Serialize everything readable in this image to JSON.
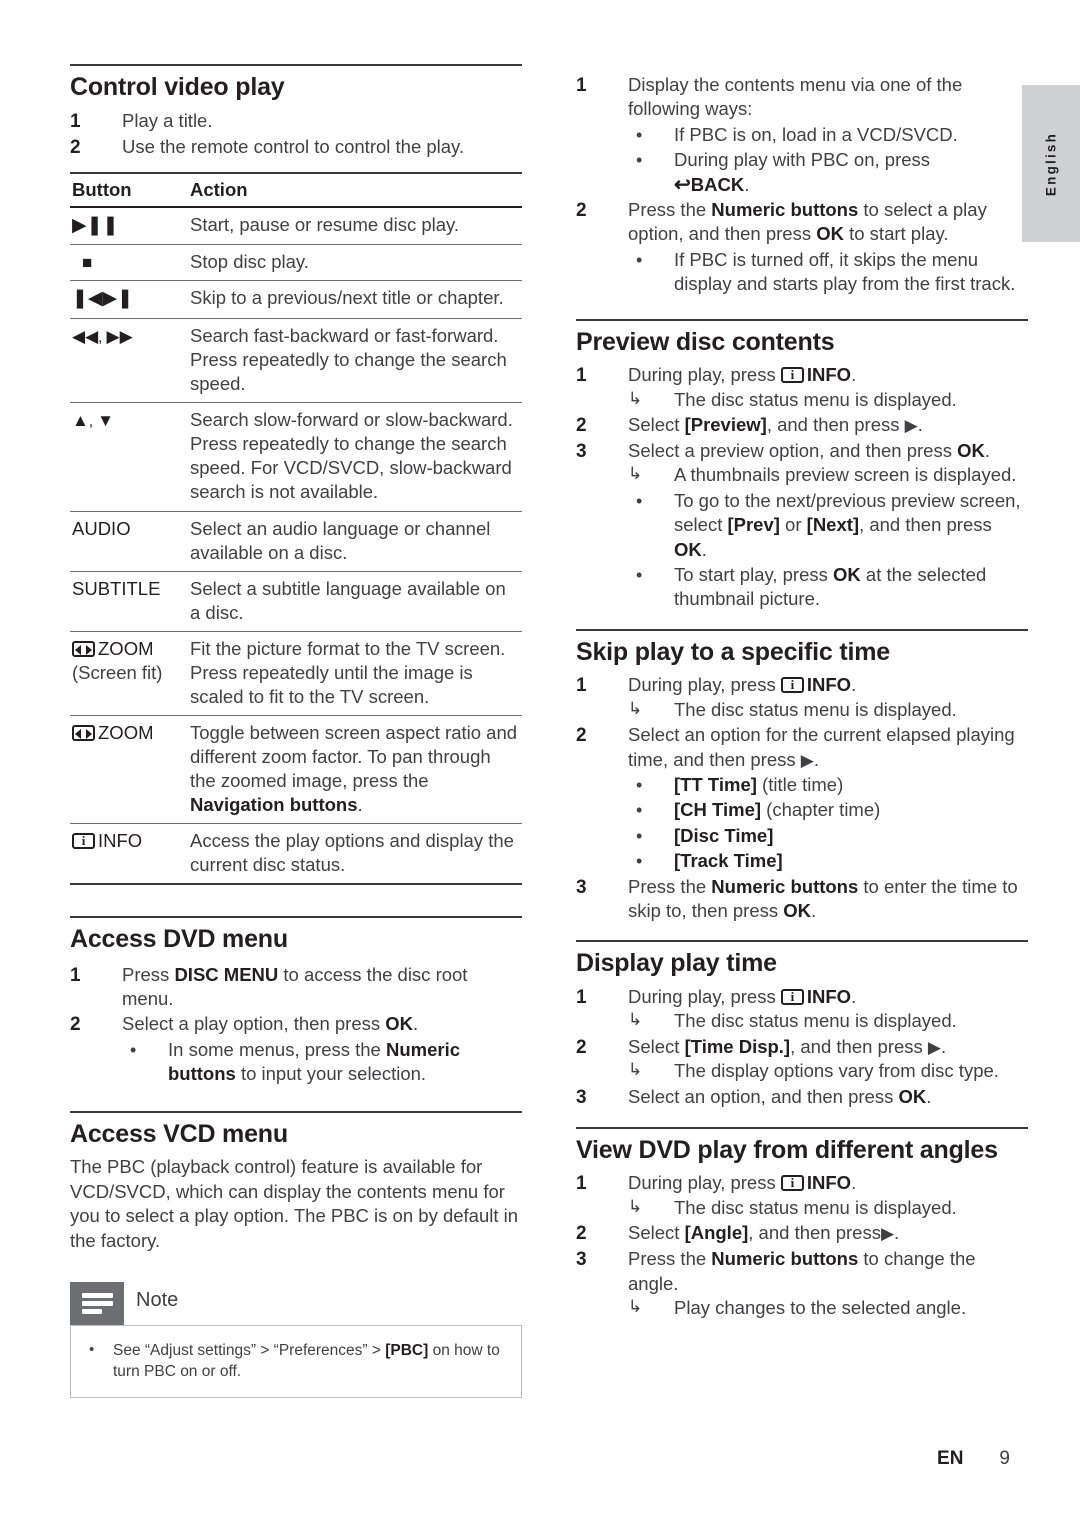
{
  "language_tab": {
    "label": "English"
  },
  "footer": {
    "lang_code": "EN",
    "page_number": "9"
  },
  "icons": {
    "play_pause": "▶▐▐",
    "stop": "■",
    "prev_next": "▌◀▶▌",
    "rewind_forward": "◀◀, ▶▶",
    "up_down": "▲, ▼",
    "zoom_label": "ZOOM",
    "info_label": "INFO",
    "back_glyph": "↰",
    "back_label": "BACK",
    "right_arrow": "▶",
    "result_arrow": "↳",
    "bullet_dot": "•",
    "info_inner": "i"
  },
  "left_column": {
    "control_video_play": {
      "title": "Control video play",
      "steps": [
        {
          "num": "1",
          "text": "Play a title."
        },
        {
          "num": "2",
          "text": "Use the remote control to control the play."
        }
      ],
      "table": {
        "headers": {
          "button": "Button",
          "action": "Action"
        },
        "rows": [
          {
            "button_kind": "play-pause",
            "button_text": "",
            "action": "Start, pause or resume disc play."
          },
          {
            "button_kind": "stop",
            "button_text": "",
            "action": "Stop disc play."
          },
          {
            "button_kind": "prev-next",
            "button_text": "",
            "action": "Skip to a previous/next title or chapter."
          },
          {
            "button_kind": "rewind-forward",
            "button_text": "",
            "action": "Search fast-backward or fast-forward. Press repeatedly to change the search speed."
          },
          {
            "button_kind": "up-down",
            "button_text": "",
            "action": "Search slow-forward or slow-backward. Press repeatedly to change the search speed. For VCD/SVCD, slow-backward search is not available."
          },
          {
            "button_kind": "text",
            "button_text": "AUDIO",
            "action": "Select an audio language or channel available on a disc."
          },
          {
            "button_kind": "text",
            "button_text": "SUBTITLE",
            "action": "Select a subtitle language available on a disc."
          },
          {
            "button_kind": "zoom",
            "button_text": "ZOOM",
            "button_sub": "(Screen fit)",
            "action": "Fit the picture format to the TV screen. Press repeatedly until the image is scaled to fit to the TV screen."
          },
          {
            "button_kind": "zoom",
            "button_text": "ZOOM",
            "action_part1": "Toggle between screen aspect ratio and different zoom factor. To pan through the zoomed image, press the ",
            "action_bold": "Navigation buttons",
            "action_part2": "."
          },
          {
            "button_kind": "info",
            "button_text": "INFO",
            "action": "Access the play options and display the current disc status."
          }
        ]
      }
    },
    "access_dvd_menu": {
      "title": "Access DVD menu",
      "step1_pre": "Press ",
      "step1_bold": "DISC MENU",
      "step1_post": " to access the disc root menu.",
      "step2_pre": "Select a play option, then press ",
      "step2_bold": "OK",
      "step2_post": ".",
      "bullet_pre": "In some menus, press the ",
      "bullet_bold": "Numeric buttons",
      "bullet_post": " to input your selection."
    },
    "access_vcd_menu": {
      "title": "Access VCD menu",
      "paragraph": "The PBC (playback control) feature is available for VCD/SVCD, which can display the contents menu for you to select a play option. The PBC is on by default in the factory."
    },
    "note": {
      "title": "Note",
      "bullet_pre": "See “Adjust settings” > “Preferences” > ",
      "bullet_bold": "[PBC]",
      "bullet_post": " on how to turn PBC on or off."
    }
  },
  "right_column": {
    "vcd_menu_steps": {
      "step1": "Display the contents menu via one of the following ways:",
      "step1_bullet1": "If PBC is on, load in a VCD/SVCD.",
      "step1_bullet2_pre": "During play with PBC on, press ",
      "step1_bullet2_bold": "BACK",
      "step1_bullet2_post": ".",
      "step2_pre": "Press the ",
      "step2_bold1": "Numeric buttons",
      "step2_mid": " to select a play option, and then press ",
      "step2_bold2": "OK",
      "step2_post": " to start play.",
      "step2_bullet": "If PBC is turned off, it skips the menu display and starts play from the first track."
    },
    "preview_disc_contents": {
      "title": "Preview disc contents",
      "step1_pre": "During play, press ",
      "step1_bold": "INFO",
      "step1_post": ".",
      "step1_result": "The disc status menu is displayed.",
      "step2_pre": "Select ",
      "step2_bold": "[Preview]",
      "step2_post": ", and then press ",
      "step3_pre": "Select a preview option, and then press ",
      "step3_bold": "OK",
      "step3_post": ".",
      "step3_result": "A thumbnails preview screen is displayed.",
      "bullet1_pre": "To go to the next/previous preview screen, select ",
      "bullet1_bold1": "[Prev]",
      "bullet1_mid": " or ",
      "bullet1_bold2": "[Next]",
      "bullet1_post": ", and then press ",
      "bullet1_bold3": "OK",
      "bullet1_end": ".",
      "bullet2_pre": "To start play, press ",
      "bullet2_bold": "OK",
      "bullet2_post": " at the selected thumbnail picture."
    },
    "skip_play_specific_time": {
      "title": "Skip play to a specific time",
      "step1_pre": "During play, press ",
      "step1_bold": "INFO",
      "step1_post": ".",
      "step1_result": "The disc status menu is displayed.",
      "step2_text": "Select an option for the current elapsed playing time, and then press ",
      "options": [
        {
          "bold": "[TT Time]",
          "plain": " (title time)"
        },
        {
          "bold": "[CH Time]",
          "plain": " (chapter time)"
        },
        {
          "bold": "[Disc Time]",
          "plain": ""
        },
        {
          "bold": "[Track Time]",
          "plain": ""
        }
      ],
      "step3_pre": "Press the ",
      "step3_bold1": "Numeric buttons",
      "step3_mid": " to enter the time to skip to, then press ",
      "step3_bold2": "OK",
      "step3_post": "."
    },
    "display_play_time": {
      "title": "Display play time",
      "step1_pre": "During play, press ",
      "step1_bold": "INFO",
      "step1_post": ".",
      "step1_result": "The disc status menu is displayed.",
      "step2_pre": "Select ",
      "step2_bold": "[Time Disp.]",
      "step2_post": ", and then press ",
      "step2_result": "The display options vary from disc type.",
      "step3_pre": "Select an option, and then press ",
      "step3_bold": "OK",
      "step3_post": "."
    },
    "view_dvd_angles": {
      "title": "View DVD play from different angles",
      "step1_pre": "During play, press ",
      "step1_bold": "INFO",
      "step1_post": ".",
      "step1_result": "The disc status menu is displayed.",
      "step2_pre": "Select ",
      "step2_bold": "[Angle]",
      "step2_post": ", and then press",
      "step3_pre": "Press the ",
      "step3_bold": "Numeric buttons",
      "step3_post": " to change the angle.",
      "step3_result": "Play changes to the selected angle."
    }
  }
}
